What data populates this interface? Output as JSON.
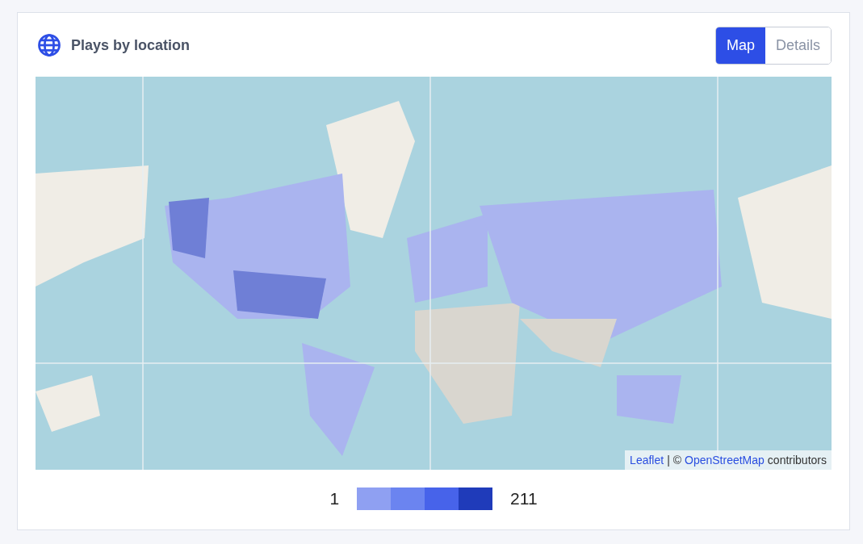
{
  "card": {
    "title": "Plays by location",
    "tabs": [
      {
        "label": "Map",
        "selected": true
      },
      {
        "label": "Details",
        "selected": false
      }
    ],
    "map": {
      "kind": "picture",
      "attribution": [
        {
          "kind": "link",
          "text": "Leaflet"
        },
        {
          "kind": "text",
          "text": "| ©"
        },
        {
          "kind": "link",
          "text": "OpenStreetMap"
        },
        {
          "kind": "text",
          "text": "contributors"
        }
      ]
    },
    "legend": {
      "min": "1",
      "max": "211",
      "swatches": [
        {
          "color": "#8fa0f2"
        },
        {
          "color": "#6b84f0"
        },
        {
          "color": "#4763ea"
        },
        {
          "color": "#1f3bba"
        }
      ]
    }
  }
}
